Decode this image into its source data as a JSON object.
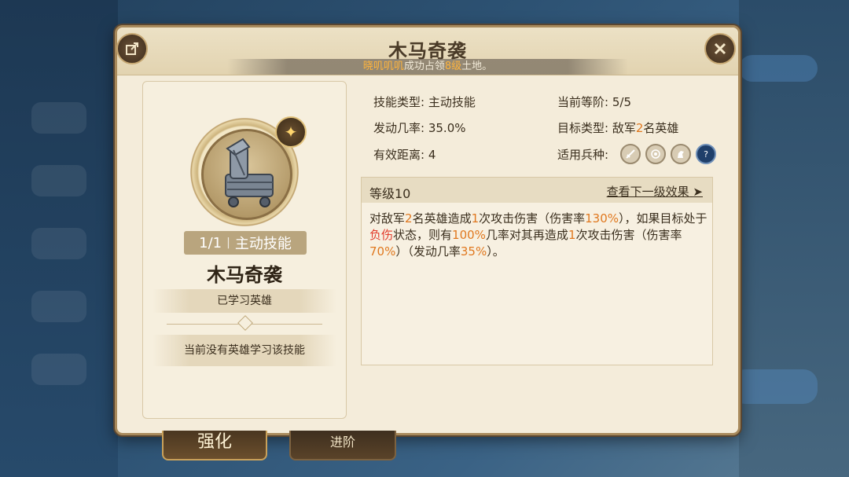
{
  "dialog": {
    "title": "木马奇袭",
    "banner": {
      "player": "晓叽叽叽",
      "mid": "成功占领",
      "level": "8级",
      "tail": "土地。"
    }
  },
  "skill_card": {
    "count": "1/1",
    "type": "主动技能",
    "name": "木马奇袭",
    "learned_label": "已学习英雄",
    "none_text": "当前没有英雄学习该技能"
  },
  "stats": {
    "type_label": "技能类型:",
    "type_value": "主动技能",
    "rate_label": "发动几率:",
    "rate_value": "35.0%",
    "range_label": "有效距离:",
    "range_value": "4",
    "rank_label": "当前等阶:",
    "rank_value": "5/5",
    "target_label": "目标类型:",
    "target_pre": "敌军",
    "target_num": "2",
    "target_post": "名英雄",
    "troop_label": "适用兵种:",
    "troop_icons": [
      "sword-icon",
      "target-icon",
      "horse-icon",
      "question-icon"
    ]
  },
  "level": {
    "label": "等级10",
    "next_link": "查看下一级效果",
    "desc": {
      "p1": "对敌军",
      "n1": "2",
      "p2": "名英雄造成",
      "n2": "1",
      "p3": "次攻击伤害（伤害率",
      "n3": "130%",
      "p4": "），如果目标处于",
      "status": "负伤",
      "p5": "状态，则有",
      "n4": "100%",
      "p6": "几率对其再造成",
      "n5": "1",
      "p7": "次攻击伤害（伤害率",
      "n6": "70%",
      "p8": "）（发动几率",
      "n7": "35%",
      "p9": "）。"
    }
  },
  "tabs": {
    "strengthen": "强化",
    "advance": "进阶"
  },
  "colors": {
    "highlight": "#e0781f",
    "status": "#e23c2c",
    "banner_highlight": "#ffb43c"
  }
}
